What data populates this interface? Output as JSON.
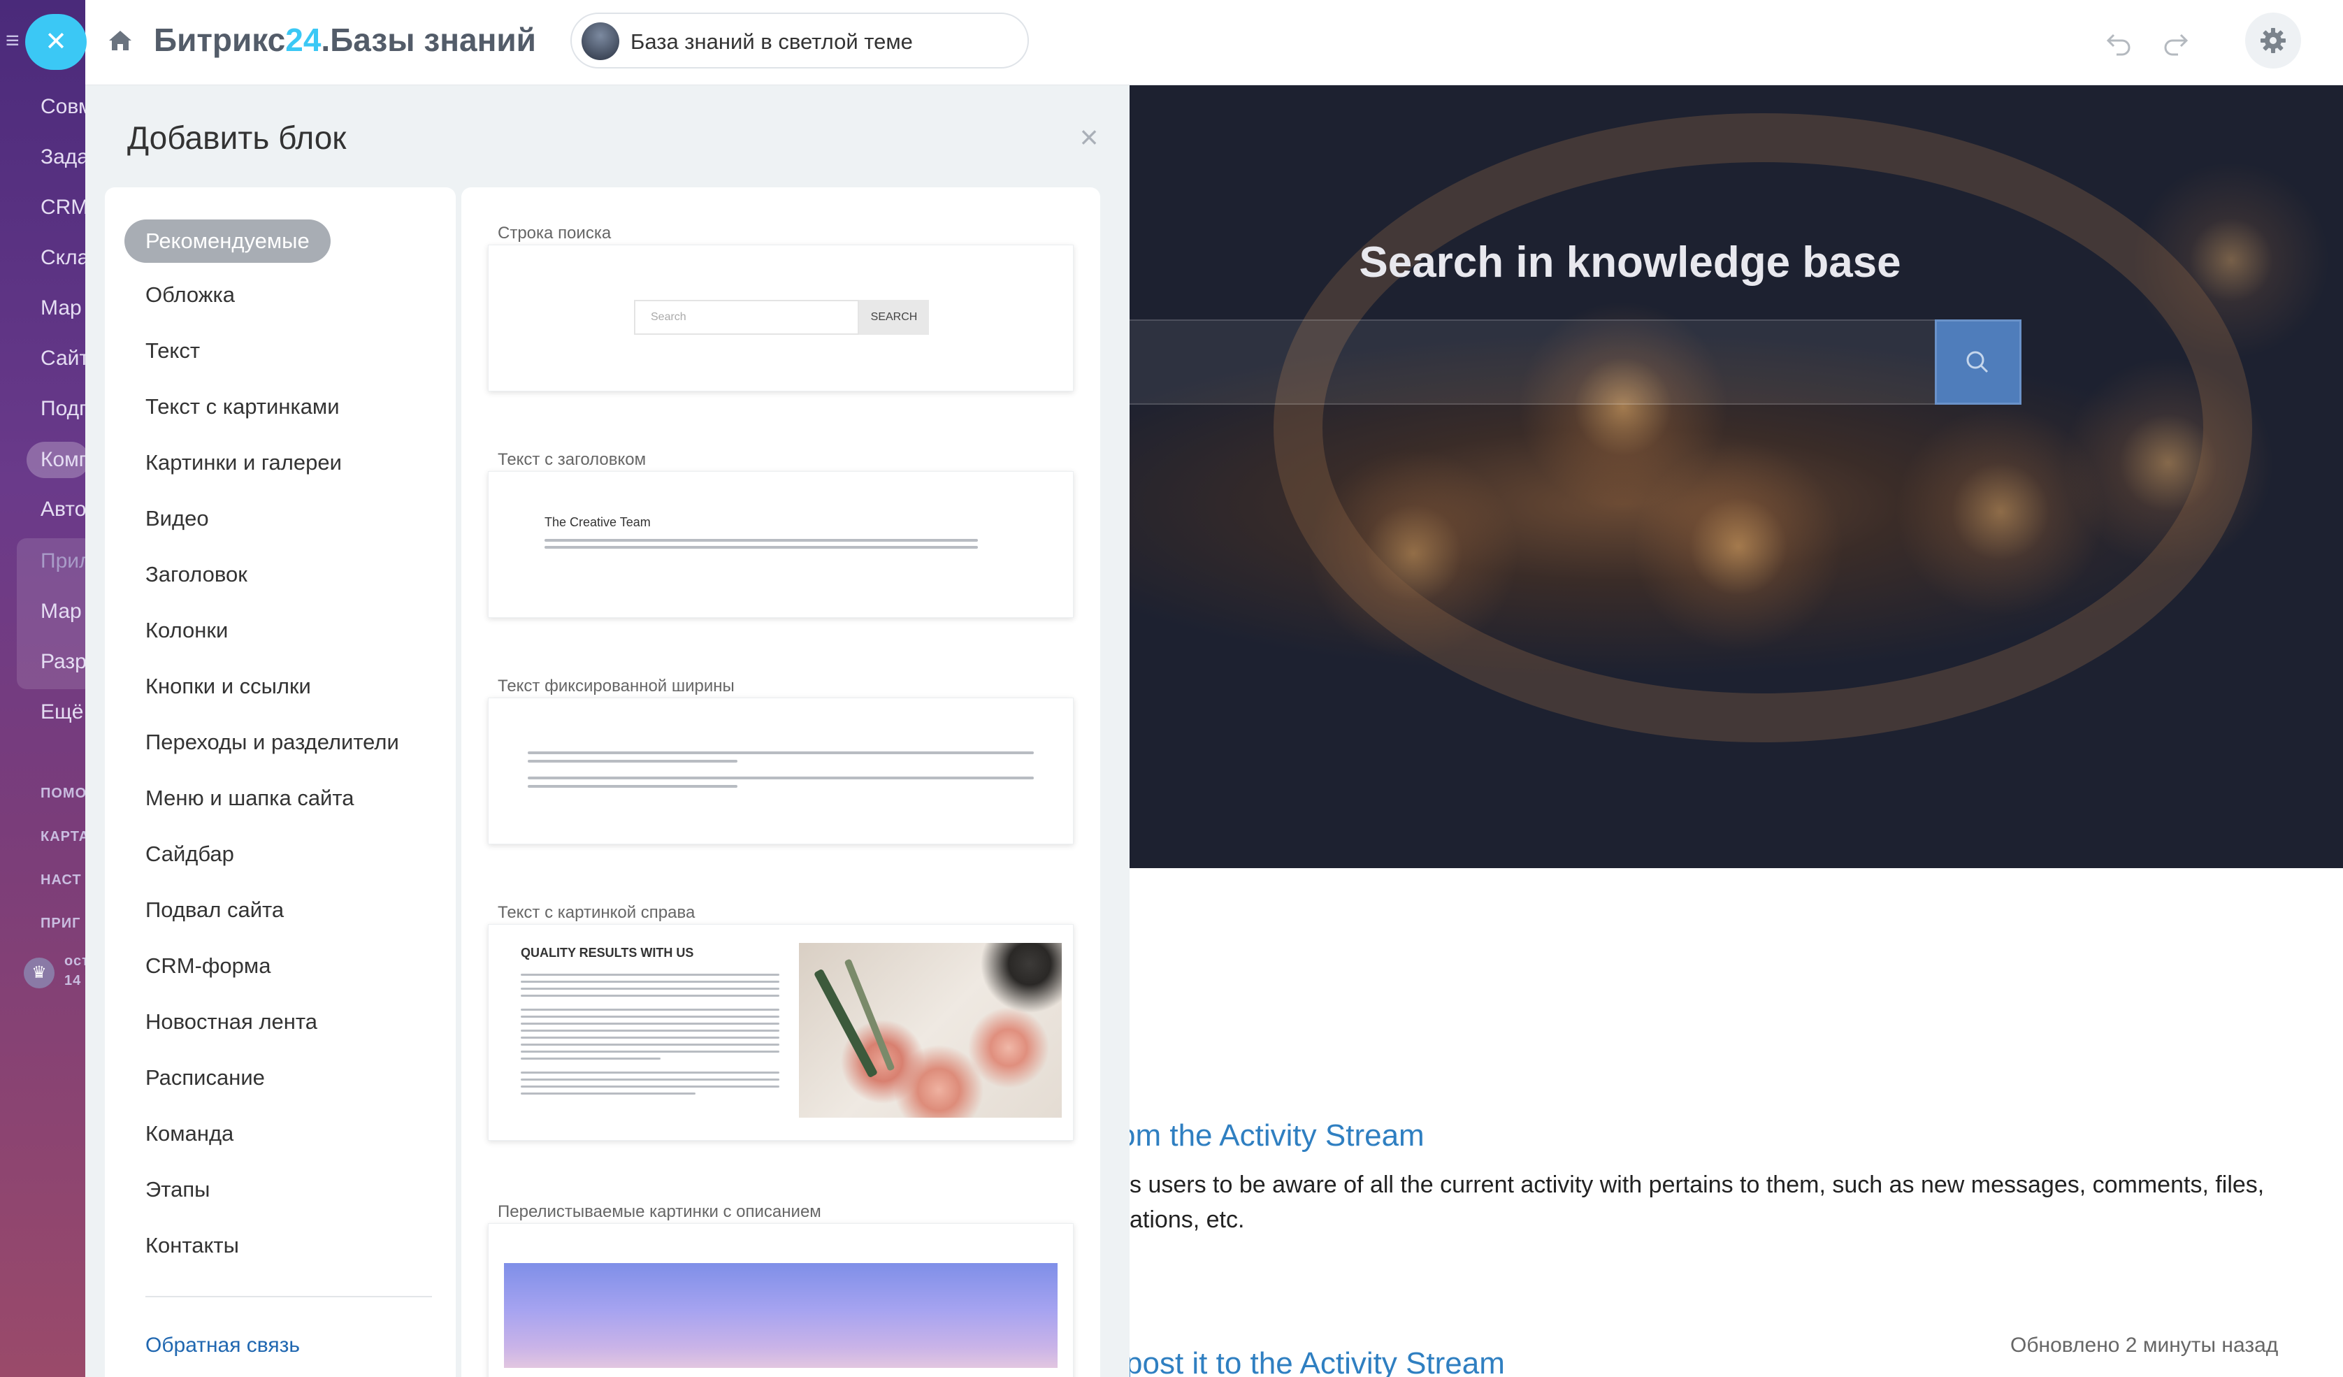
{
  "portal": {
    "items": [
      "Совм",
      "Зада",
      "CRM",
      "Скла",
      "Мар",
      "Сайт",
      "Подп",
      "Комп",
      "Авто",
      "Прил",
      "Мар",
      "Разр",
      "Ещё"
    ],
    "small_items": [
      "ПОМО",
      "КАРТА",
      "НАСТ",
      "ПРИГ"
    ],
    "avatar_text": "ост",
    "avatar_sub": "14"
  },
  "topbar": {
    "title_prefix": "Битрикс",
    "title_number": "24",
    "title_suffix": ".Базы знаний",
    "site_name": "База знаний в светлой теме"
  },
  "panel": {
    "title": "Добавить блок",
    "categories": [
      "Рекомендуемые",
      "Обложка",
      "Текст",
      "Текст с картинками",
      "Картинки и галереи",
      "Видео",
      "Заголовок",
      "Колонки",
      "Кнопки и ссылки",
      "Переходы и разделители",
      "Меню и шапка сайта",
      "Сайдбар",
      "Подвал сайта",
      "CRM-форма",
      "Новостная лента",
      "Расписание",
      "Команда",
      "Этапы",
      "Контакты"
    ],
    "feedback": "Обратная связь",
    "blocks": [
      {
        "label": "Строка поиска",
        "search_placeholder": "Search",
        "search_button": "SEARCH"
      },
      {
        "label": "Текст с заголовком",
        "heading": "The Creative Team"
      },
      {
        "label": "Текст фиксированной ширины"
      },
      {
        "label": "Текст с картинкой справа",
        "heading": "QUALITY RESULTS WITH US"
      },
      {
        "label": "Перелистываемые картинки с описанием"
      }
    ]
  },
  "preview": {
    "hero_title": "Search in knowledge base",
    "article1_link": "om the Activity Stream",
    "article1_line1": "s users to be aware of all the current activity with pertains to them, such as new messages, comments, files,",
    "article1_line2": "ations, etc.",
    "article2_link": "post it to the Activity Stream",
    "updated": "Обновлено 2 минуты назад"
  },
  "colors": {
    "accent": "#3bc8f5",
    "link": "#2f7fc1",
    "active_category": "#a8adb4",
    "search_button": "#4f7dbb"
  }
}
